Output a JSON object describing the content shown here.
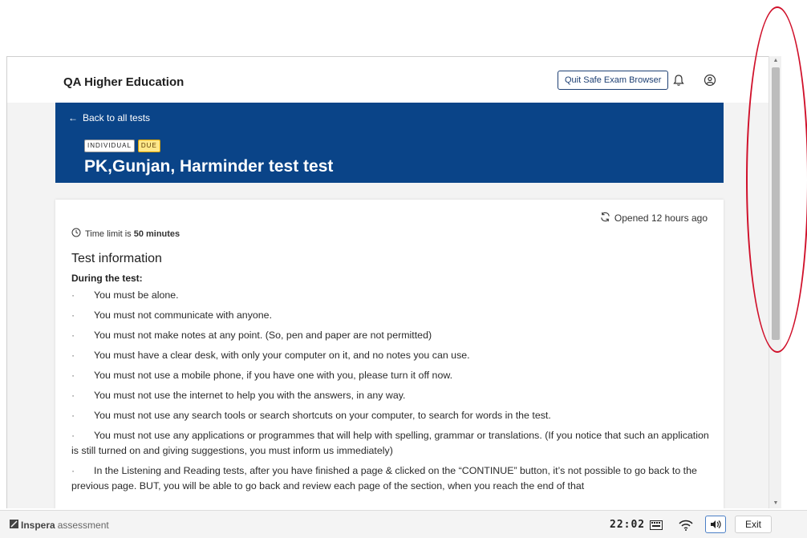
{
  "header": {
    "org_name": "QA Higher Education",
    "quit_label": "Quit Safe Exam Browser",
    "bell_icon": "bell-icon",
    "user_icon": "user-circle-icon"
  },
  "banner": {
    "back_label": "Back to all tests",
    "badge_individual": "INDIVIDUAL",
    "badge_due": "DUE",
    "title": "PK,Gunjan, Harminder test test",
    "bg_color": "#0a4488"
  },
  "card": {
    "opened_label": "Opened 12 hours ago",
    "time_prefix": "Time limit is ",
    "time_value": "50 minutes",
    "heading": "Test information",
    "subheading": "During the test:",
    "bullet": "·",
    "rules": [
      "You must be alone.",
      "You must not communicate with anyone.",
      "You must not make notes at any point. (So, pen and paper are not permitted)",
      "You must have a clear desk, with only your computer on it, and no notes you can use.",
      "You must not use a mobile phone, if you have one with you, please turn it off now.",
      "You must not use the internet to help you with the answers, in any way.",
      "You must not use any search tools or search shortcuts on your computer, to search for words in the test.",
      "You must not use any applications or programmes that will help with spelling, grammar or translations. (If you notice that such an application is still turned on and giving suggestions, you must inform us immediately)",
      "In the Listening and Reading tests, after you have finished a page & clicked on the “CONTINUE” button, it’s not possible to go back to the previous page. BUT, you will be able to go back and review each page of the section, when you reach the end of that"
    ]
  },
  "taskbar": {
    "brand_bold": "Inspera",
    "brand_light": "assessment",
    "clock": "22:02",
    "exit_label": "Exit",
    "keyboard_icon": "keyboard-icon",
    "wifi_icon": "wifi-icon",
    "volume_icon": "volume-icon"
  }
}
